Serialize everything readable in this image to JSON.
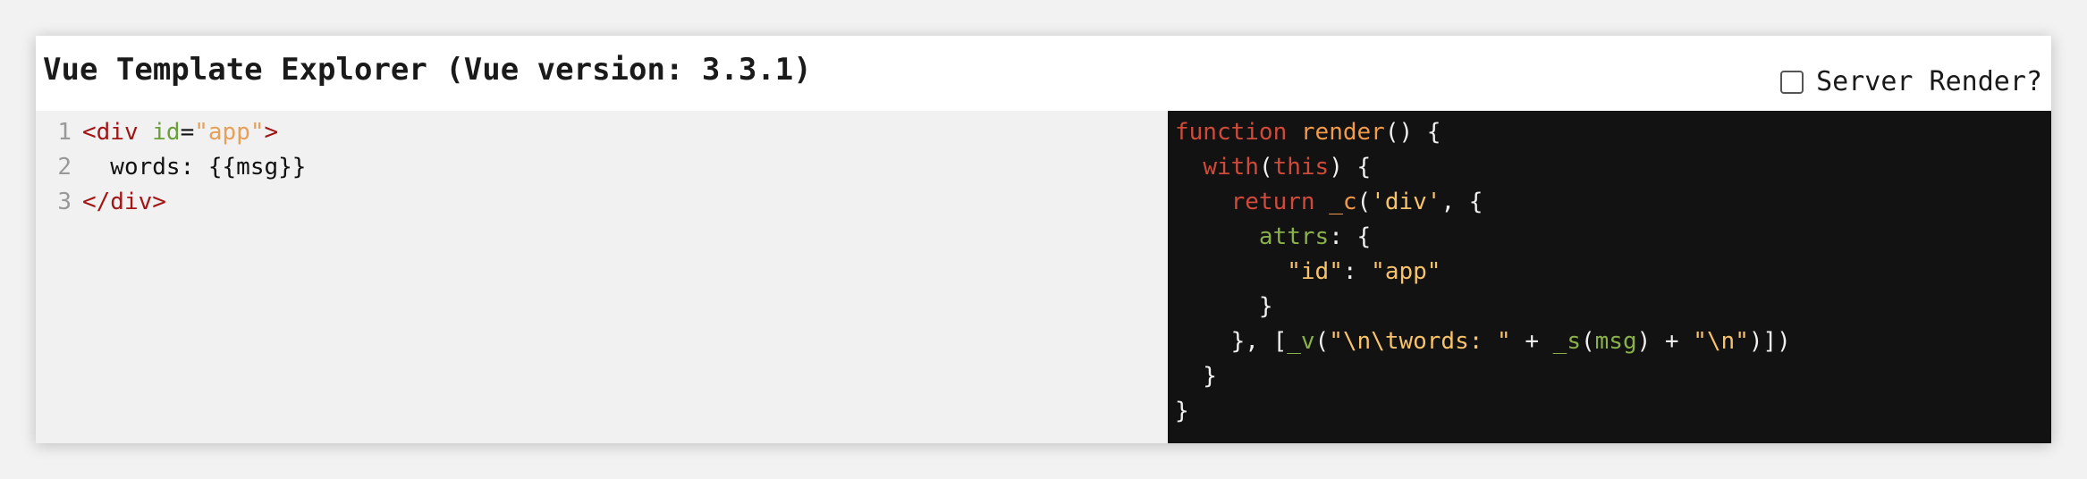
{
  "app": {
    "title": "Vue Template Explorer (Vue version: 3.3.1)",
    "server_render_label": "Server Render?",
    "server_render_checked": false
  },
  "editor": {
    "lines": [
      {
        "num": "1",
        "parts": [
          {
            "t": "<div ",
            "c": "tag"
          },
          {
            "t": "id",
            "c": "attr"
          },
          {
            "t": "=",
            "c": "plain"
          },
          {
            "t": "\"app\"",
            "c": "str"
          },
          {
            "t": ">",
            "c": "tag"
          }
        ]
      },
      {
        "num": "2",
        "parts": [
          {
            "t": "  words: {{msg}}",
            "c": "plain"
          }
        ]
      },
      {
        "num": "3",
        "parts": [
          {
            "t": "</div>",
            "c": "tag"
          }
        ]
      }
    ]
  },
  "output": {
    "lines": [
      [
        {
          "t": "function",
          "c": "kw"
        },
        {
          "t": " ",
          "c": "plain"
        },
        {
          "t": "render",
          "c": "fn"
        },
        {
          "t": "() {",
          "c": "plain"
        }
      ],
      [
        {
          "t": "  ",
          "c": "plain"
        },
        {
          "t": "with",
          "c": "kw"
        },
        {
          "t": "(",
          "c": "plain"
        },
        {
          "t": "this",
          "c": "kw"
        },
        {
          "t": ") {",
          "c": "plain"
        }
      ],
      [
        {
          "t": "    ",
          "c": "plain"
        },
        {
          "t": "return",
          "c": "kw"
        },
        {
          "t": " ",
          "c": "plain"
        },
        {
          "t": "_c",
          "c": "fn"
        },
        {
          "t": "(",
          "c": "plain"
        },
        {
          "t": "'div'",
          "c": "ostr"
        },
        {
          "t": ", {",
          "c": "plain"
        }
      ],
      [
        {
          "t": "      ",
          "c": "plain"
        },
        {
          "t": "attrs",
          "c": "prop"
        },
        {
          "t": ": {",
          "c": "plain"
        }
      ],
      [
        {
          "t": "        ",
          "c": "plain"
        },
        {
          "t": "\"id\"",
          "c": "ostr"
        },
        {
          "t": ": ",
          "c": "plain"
        },
        {
          "t": "\"app\"",
          "c": "ostr"
        }
      ],
      [
        {
          "t": "      }",
          "c": "plain"
        }
      ],
      [
        {
          "t": "    }, [",
          "c": "plain"
        },
        {
          "t": "_v",
          "c": "ident"
        },
        {
          "t": "(",
          "c": "plain"
        },
        {
          "t": "\"\\n\\twords: \"",
          "c": "ostr"
        },
        {
          "t": " + ",
          "c": "plain"
        },
        {
          "t": "_s",
          "c": "ident"
        },
        {
          "t": "(",
          "c": "plain"
        },
        {
          "t": "msg",
          "c": "ident"
        },
        {
          "t": ") + ",
          "c": "plain"
        },
        {
          "t": "\"\\n\"",
          "c": "ostr"
        },
        {
          "t": ")])",
          "c": "plain"
        }
      ],
      [
        {
          "t": "  }",
          "c": "plain"
        }
      ],
      [
        {
          "t": "}",
          "c": "plain"
        }
      ]
    ]
  }
}
